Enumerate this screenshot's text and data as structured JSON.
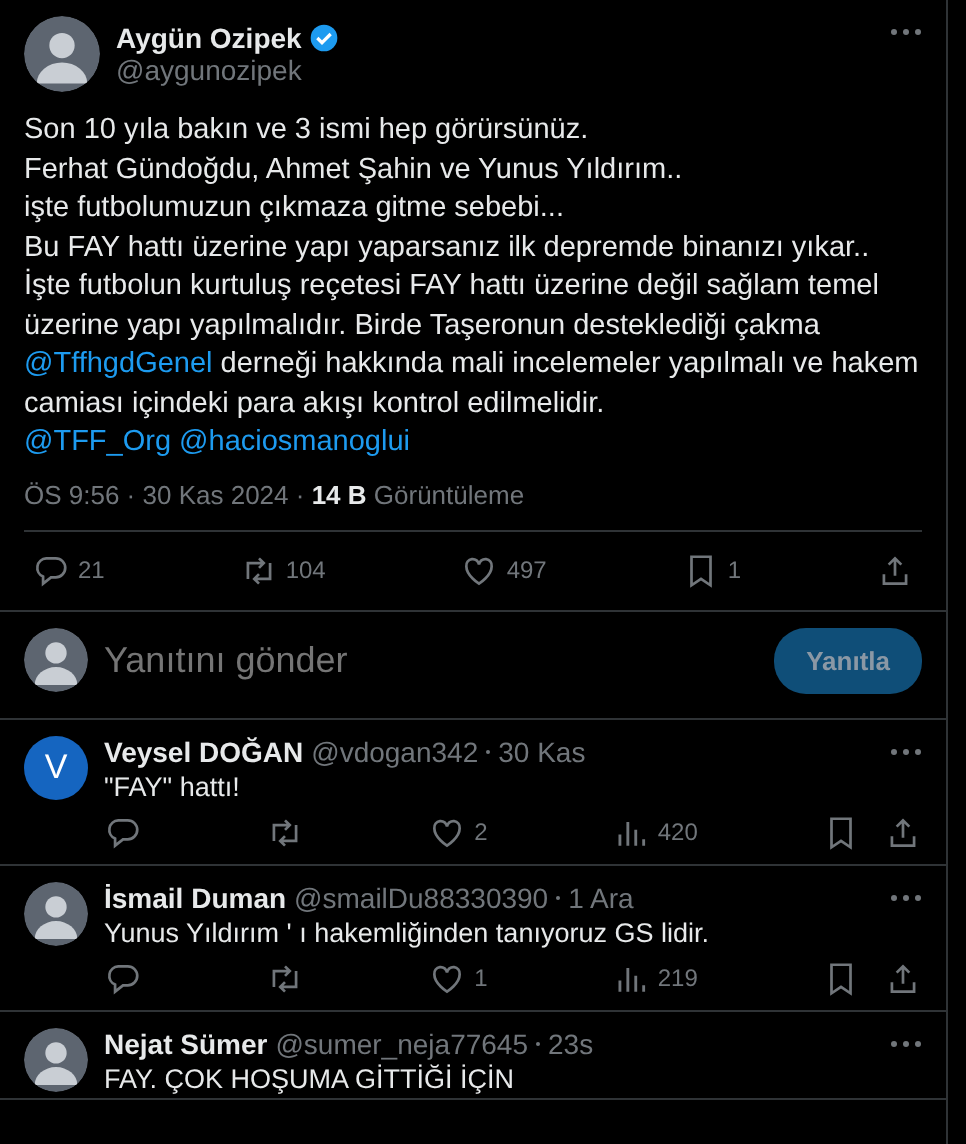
{
  "tweet": {
    "author": {
      "name": "Aygün Ozipek",
      "verified": true,
      "handle": "@aygunozipek"
    },
    "lines": [
      [
        {
          "kind": "text",
          "text": "Son 10 yıla bakın ve 3 ismi hep görürsünüz."
        }
      ],
      [
        {
          "kind": "text",
          "text": "Ferhat Gündoğdu, Ahmet Şahin ve Yunus Yıldırım.."
        }
      ],
      [
        {
          "kind": "text",
          "text": "işte futbolumuzun çıkmaza gitme sebebi..."
        }
      ],
      [
        {
          "kind": "text",
          "text": "Bu FAY hattı üzerine yapı yaparsanız ilk depremde binanızı yıkar.."
        }
      ],
      [
        {
          "kind": "text",
          "text": "İşte futbolun kurtuluş reçetesi FAY hattı üzerine değil sağlam temel"
        }
      ],
      [
        {
          "kind": "text",
          "text": "üzerine yapı yapılmalıdır. Birde Taşeronun desteklediği çakma"
        }
      ],
      [
        {
          "kind": "mention",
          "text": "@TffhgdGenel"
        },
        {
          "kind": "text",
          "text": "derneği hakkında mali incelemeler yapılmalı ve hakem"
        }
      ],
      [
        {
          "kind": "text",
          "text": "camiası içindeki para akışı kontrol edilmelidir."
        }
      ],
      [
        {
          "kind": "mention",
          "text": "@TFF_Org"
        },
        {
          "kind": "mention",
          "text": "@haciosmanoglui"
        }
      ]
    ],
    "meta": "ÖS 9:56 · 30 Kas 2024 · **14 B** Görüntüleme",
    "actions": [
      {
        "kind": "reply",
        "count": "21"
      },
      {
        "kind": "retweet",
        "count": "104"
      },
      {
        "kind": "like",
        "count": "497"
      },
      {
        "kind": "bookmark",
        "count": "1"
      },
      {
        "kind": "share"
      }
    ]
  },
  "composer": {
    "placeholder": "Yanıtını gönder",
    "button": "Yanıtla",
    "disabled": true
  },
  "replies": [
    {
      "avatar": {
        "kind": "letter",
        "letter": "V"
      },
      "name": "Veysel DOĞAN",
      "handle": "@vdogan342",
      "time": "30 Kas",
      "text": "\"FAY\" hattı!",
      "actions": [
        {
          "kind": "reply"
        },
        {
          "kind": "retweet"
        },
        {
          "kind": "like",
          "count": "2"
        },
        {
          "kind": "views",
          "count": "420"
        },
        {
          "kind": "bookmark"
        },
        {
          "kind": "share"
        }
      ]
    },
    {
      "avatar": {
        "kind": "photo"
      },
      "name": "İsmail Duman",
      "handle": "@smailDu88330390",
      "time": "1 Ara",
      "text": "Yunus Yıldırım ' ı hakemliğinden tanıyoruz GS lidir.",
      "actions": [
        {
          "kind": "reply"
        },
        {
          "kind": "retweet"
        },
        {
          "kind": "like",
          "count": "1"
        },
        {
          "kind": "views",
          "count": "219"
        },
        {
          "kind": "bookmark"
        },
        {
          "kind": "share"
        }
      ]
    },
    {
      "avatar": {
        "kind": "photo"
      },
      "name": "Nejat Sümer",
      "handle": "@sumer_neja77645",
      "time": "23s",
      "text": "FAY. ÇOK HOŞUMA GİTTİĞİ İÇİN"
    }
  ]
}
